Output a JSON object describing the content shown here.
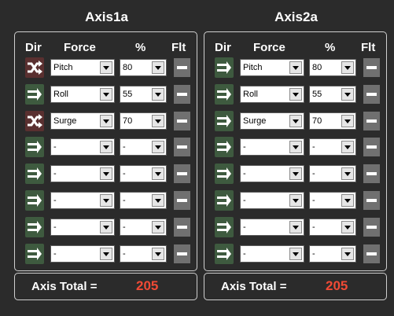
{
  "headers": {
    "dir": "Dir",
    "force": "Force",
    "percent": "%",
    "flt": "Flt"
  },
  "colors": {
    "dir_green": "#3e5a3f",
    "dir_red": "#5a3030",
    "total_value": "#f04a35"
  },
  "axes": [
    {
      "title": "Axis1a",
      "total_label": "Axis Total =",
      "total_value": "205",
      "rows": [
        {
          "dir_icon": "shuffle-icon",
          "force": "Pitch",
          "percent": "80"
        },
        {
          "dir_icon": "arrow-right-icon",
          "force": "Roll",
          "percent": "55"
        },
        {
          "dir_icon": "shuffle-icon",
          "force": "Surge",
          "percent": "70"
        },
        {
          "dir_icon": "arrow-right-icon",
          "force": "-",
          "percent": "-"
        },
        {
          "dir_icon": "arrow-right-icon",
          "force": "-",
          "percent": "-"
        },
        {
          "dir_icon": "arrow-right-icon",
          "force": "-",
          "percent": "-"
        },
        {
          "dir_icon": "arrow-right-icon",
          "force": "-",
          "percent": "-"
        },
        {
          "dir_icon": "arrow-right-icon",
          "force": "-",
          "percent": "-"
        }
      ]
    },
    {
      "title": "Axis2a",
      "total_label": "Axis Total =",
      "total_value": "205",
      "rows": [
        {
          "dir_icon": "arrow-right-icon",
          "force": "Pitch",
          "percent": "80"
        },
        {
          "dir_icon": "arrow-right-icon",
          "force": "Roll",
          "percent": "55"
        },
        {
          "dir_icon": "arrow-right-icon",
          "force": "Surge",
          "percent": "70"
        },
        {
          "dir_icon": "arrow-right-icon",
          "force": "-",
          "percent": "-"
        },
        {
          "dir_icon": "arrow-right-icon",
          "force": "-",
          "percent": "-"
        },
        {
          "dir_icon": "arrow-right-icon",
          "force": "-",
          "percent": "-"
        },
        {
          "dir_icon": "arrow-right-icon",
          "force": "-",
          "percent": "-"
        },
        {
          "dir_icon": "arrow-right-icon",
          "force": "-",
          "percent": "-"
        }
      ]
    }
  ]
}
